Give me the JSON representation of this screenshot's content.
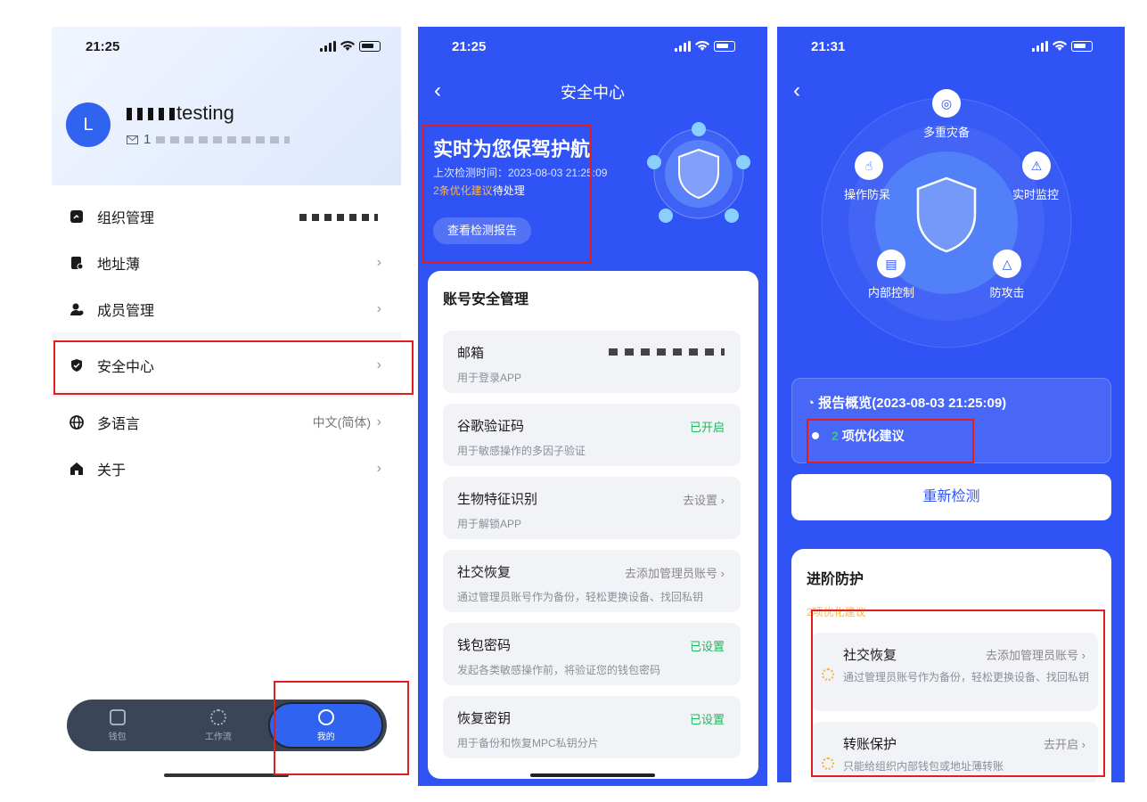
{
  "colors": {
    "accent": "#2f53f5",
    "success": "#1cb85c",
    "warning": "#ffb64a",
    "highlight": "#e01e1e"
  },
  "profile": {
    "time": "21:25",
    "avatar_initial": "L",
    "name_suffix": "testing",
    "email_prefix": "1",
    "menu": [
      {
        "label": "组织管理",
        "icon": "org-icon"
      },
      {
        "label": "地址薄",
        "icon": "addressbook-icon"
      },
      {
        "label": "成员管理",
        "icon": "members-icon"
      },
      {
        "label": "安全中心",
        "icon": "shield-icon"
      },
      {
        "label": "多语言",
        "icon": "globe-icon",
        "value": "中文(简体)"
      },
      {
        "label": "关于",
        "icon": "home-icon"
      }
    ],
    "tabs": [
      {
        "label": "钱包",
        "icon": "wallet-icon"
      },
      {
        "label": "工作流",
        "icon": "workflow-icon"
      },
      {
        "label": "我的",
        "icon": "profile-icon"
      }
    ]
  },
  "security": {
    "time": "21:25",
    "title": "安全中心",
    "hero_title": "实时为您保驾护航",
    "last_check": "上次检测时间：2023-08-03 21:25:09",
    "pending_highlight": "2条优化建议",
    "pending_suffix": "待处理",
    "report_button": "查看检测报告",
    "section_title": "账号安全管理",
    "items": [
      {
        "title": "邮箱",
        "desc": "用于登录APP",
        "value": ""
      },
      {
        "title": "谷歌验证码",
        "desc": "用于敏感操作的多因子验证",
        "value": "已开启"
      },
      {
        "title": "生物特征识别",
        "desc": "用于解锁APP",
        "value": "去设置 ›"
      },
      {
        "title": "社交恢复",
        "desc": "通过管理员账号作为备份，轻松更换设备、找回私钥",
        "value": "去添加管理员账号 ›"
      },
      {
        "title": "钱包密码",
        "desc": "发起各类敏感操作前，将验证您的钱包密码",
        "value": "已设置"
      },
      {
        "title": "恢复密钥",
        "desc": "用于备份和恢复MPC私钥分片",
        "value": "已设置"
      }
    ]
  },
  "report": {
    "time": "21:31",
    "radar_labels": [
      "多重灾备",
      "操作防呆",
      "实时监控",
      "内部控制",
      "防攻击"
    ],
    "overview_title": "报告概览(2023-08-03 21:25:09)",
    "overview_count": "2",
    "overview_text": "项优化建议",
    "recheck_button": "重新检测",
    "advanced_title": "进阶防护",
    "advanced_sub": "2项优化建议",
    "advanced": [
      {
        "title": "社交恢复",
        "desc": "通过管理员账号作为备份，轻松更换设备、找回私钥",
        "value": "去添加管理员账号 ›"
      },
      {
        "title": "转账保护",
        "desc": "只能给组织内部钱包或地址薄转账",
        "value": "去开启 ›"
      }
    ]
  }
}
